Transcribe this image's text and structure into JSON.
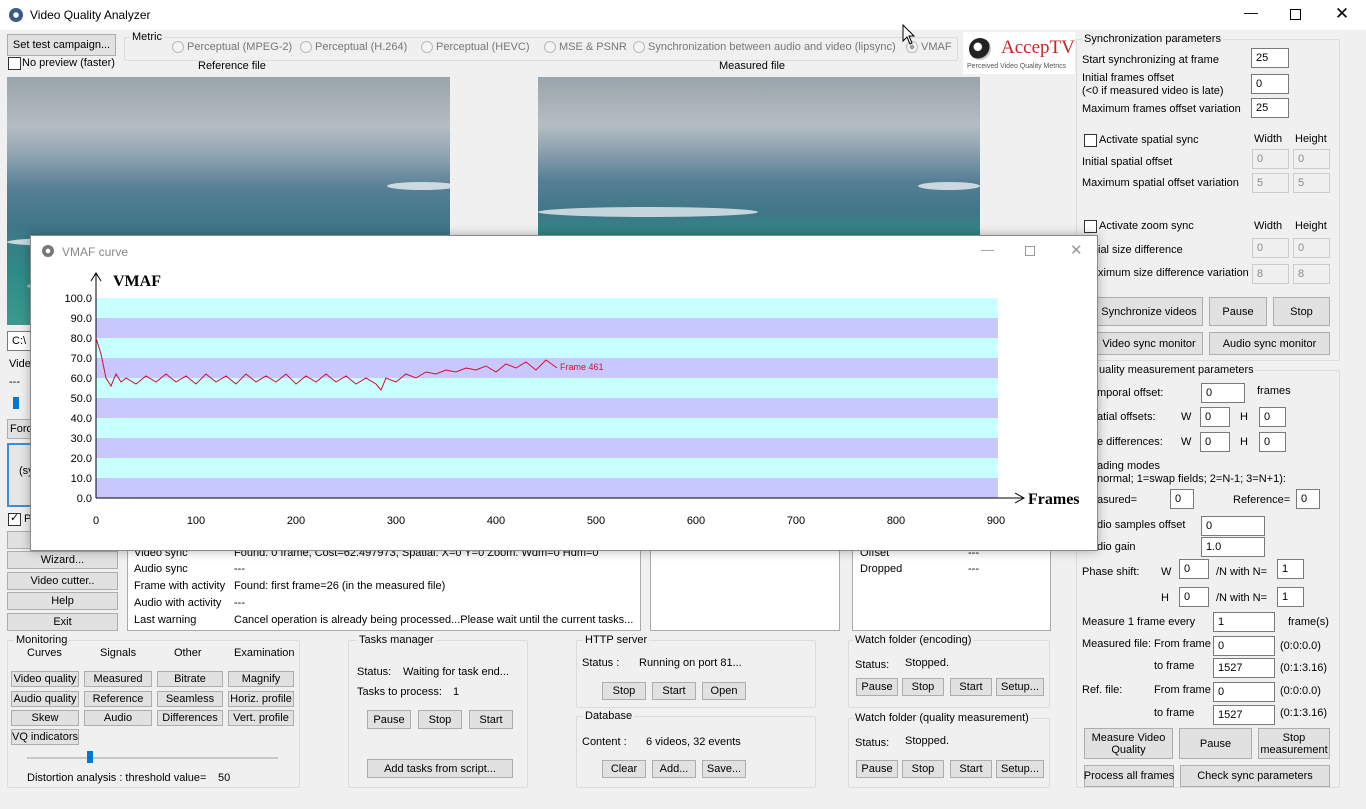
{
  "app": {
    "title": "Video Quality Analyzer",
    "logo_brand": "AccepTV",
    "logo_tagline": "Perceived Video Quality Metrics"
  },
  "top": {
    "set_campaign": "Set test campaign...",
    "no_preview": "No preview (faster)",
    "metric_label": "Metric",
    "metrics": [
      "Perceptual (MPEG-2)",
      "Perceptual (H.264)",
      "Perceptual (HEVC)",
      "MSE & PSNR",
      "Synchronization between audio and video (lipsync)",
      "VMAF"
    ],
    "reference_file": "Reference file",
    "measured_file": "Measured file"
  },
  "left": {
    "path_fragment": "C:\\",
    "video_fragment": "Vide",
    "dashes": "---",
    "force_fragment": "Forc",
    "sy_fragment": "(sy",
    "p_fragment": "P",
    "wizard": "Wizard...",
    "video_cutter": "Video cutter..",
    "help": "Help",
    "exit": "Exit"
  },
  "log": {
    "rows": [
      {
        "k": "Video sync",
        "v": "Found: 0 frame, Cost=62.497973, Spatial: X=0 Y=0 Zoom: Wdm=0 Hdm=0"
      },
      {
        "k": "Audio sync",
        "v": "---"
      },
      {
        "k": "Frame with activity",
        "v": "Found: first frame=26 (in the measured file)"
      },
      {
        "k": "Audio with activity",
        "v": "---"
      },
      {
        "k": "Last warning",
        "v": "Cancel operation is already being processed...Please wait until the current tasks..."
      }
    ],
    "offset_label": "Offset",
    "offset_value": "---",
    "dropped_label": "Dropped",
    "dropped_value": "---"
  },
  "monitoring": {
    "title": "Monitoring",
    "headers": [
      "Curves",
      "Signals",
      "Other",
      "Examination"
    ],
    "buttons": [
      [
        "Video quality",
        "Measured",
        "Bitrate",
        "Magnify"
      ],
      [
        "Audio quality",
        "Reference",
        "Seamless",
        "Horiz. profile"
      ],
      [
        "Skew",
        "Audio",
        "Differences",
        "Vert. profile"
      ],
      [
        "VQ indicators"
      ]
    ],
    "threshold_label": "Distortion analysis : threshold value=",
    "threshold_value": "50",
    "threshold_fraction": 0.25
  },
  "tasks": {
    "title": "Tasks manager",
    "status_label": "Status:",
    "status_value": "Waiting for task end...",
    "to_process_label": "Tasks to process:",
    "to_process_value": "1",
    "pause": "Pause",
    "stop": "Stop",
    "start": "Start",
    "add_script": "Add tasks from script..."
  },
  "http": {
    "title": "HTTP server",
    "status_label": "Status :",
    "status_value": "Running on port 81...",
    "stop": "Stop",
    "start": "Start",
    "open": "Open"
  },
  "database": {
    "title": "Database",
    "content_label": "Content :",
    "content_value": "6 videos, 32 events",
    "clear": "Clear",
    "add": "Add...",
    "save": "Save..."
  },
  "watch_encoding": {
    "title": "Watch folder (encoding)",
    "status_label": "Status:",
    "status_value": "Stopped.",
    "pause": "Pause",
    "stop": "Stop",
    "start": "Start",
    "setup": "Setup..."
  },
  "watch_quality": {
    "title": "Watch folder (quality measurement)",
    "status_label": "Status:",
    "status_value": "Stopped.",
    "pause": "Pause",
    "stop": "Stop",
    "start": "Start",
    "setup": "Setup..."
  },
  "sync": {
    "title": "Synchronization parameters",
    "start_label": "Start synchronizing at frame",
    "start_value": "25",
    "initial_offset_label": "Initial frames offset",
    "initial_offset_sub": "(<0 if measured video is late)",
    "initial_offset_value": "0",
    "max_offset_label": "Maximum frames offset variation",
    "max_offset_value": "25",
    "spatial_chk": "Activate spatial sync",
    "width": "Width",
    "height": "Height",
    "initial_spatial": "Initial spatial offset",
    "is_w": "0",
    "is_h": "0",
    "max_spatial": "Maximum spatial offset variation",
    "ms_w": "5",
    "ms_h": "5",
    "zoom_chk": "Activate zoom sync",
    "initial_size": "ial size difference",
    "iz_w": "0",
    "iz_h": "0",
    "max_size": "ximum size difference variation",
    "mz_w": "8",
    "mz_h": "8",
    "sync_videos": "Synchronize videos",
    "pause": "Pause",
    "stop": "Stop",
    "video_monitor": "Video sync monitor",
    "audio_monitor": "Audio sync monitor"
  },
  "quality": {
    "title": "uality measurement parameters",
    "temporal_label": "mporal offset:",
    "temporal_value": "0",
    "frames": "frames",
    "spatial_label": "atial offsets:",
    "w": "W",
    "h": "H",
    "so_w": "0",
    "so_h": "0",
    "size_label": "e differences:",
    "sd_w": "0",
    "sd_h": "0",
    "reading_label": "ading modes",
    "reading_sub": "normal; 1=swap fields; 2=N-1; 3=N+1):",
    "measured_label": "asured=",
    "measured_value": "0",
    "reference_label": "Reference=",
    "reference_value": "0",
    "audio_offset_label": "dio samples offset",
    "audio_offset_value": "0",
    "audio_gain_label": "dio gain",
    "audio_gain_value": "1.0",
    "phase_label": "Phase shift:",
    "pw": "0",
    "n_label": "/N with N=",
    "pw_n": "1",
    "ph": "0",
    "ph_n": "1",
    "measure_every_label": "Measure 1 frame every",
    "measure_every_value": "1",
    "frames_unit": "frame(s)",
    "measured_file_label": "Measured file:",
    "from_frame": "From frame",
    "mf_from": "0",
    "mf_from_time": "(0:0:0.0)",
    "to_frame": "to frame",
    "mf_to": "1527",
    "mf_to_time": "(0:1:3.16)",
    "ref_file_label": "Ref. file:",
    "rf_from": "0",
    "rf_from_time": "(0:0:0.0)",
    "rf_to": "1527",
    "rf_to_time": "(0:1:3.16)",
    "measure_btn": "Measure Video Quality",
    "pause": "Pause",
    "stop_btn": "Stop measurement",
    "process_all": "Process all frames",
    "check_sync": "Check sync parameters"
  },
  "vmaf_window": {
    "title": "VMAF curve",
    "y_title": "VMAF",
    "x_title": "Frames",
    "frame_label": "Frame 461"
  },
  "chart_data": {
    "type": "line",
    "title": "",
    "ylabel": "VMAF",
    "xlabel": "Frames",
    "xlim": [
      0,
      900
    ],
    "ylim": [
      0,
      100
    ],
    "x_ticks": [
      0,
      100,
      200,
      300,
      400,
      500,
      600,
      700,
      800,
      900
    ],
    "y_ticks": [
      "0.0",
      "10.0",
      "20.0",
      "30.0",
      "40.0",
      "50.0",
      "60.0",
      "70.0",
      "80.0",
      "90.0",
      "100.0"
    ],
    "band_colors": [
      "#c8c8ff",
      "#c8ffff"
    ],
    "line_color": "#d01030",
    "series": [
      {
        "x": [
          0,
          5,
          10,
          15,
          20,
          25,
          30,
          40,
          50,
          60,
          70,
          80,
          90,
          100,
          110,
          120,
          130,
          140,
          150,
          160,
          170,
          180,
          190,
          200,
          210,
          220,
          230,
          240,
          250,
          260,
          270,
          280,
          285,
          290,
          300,
          310,
          320,
          330,
          340,
          350,
          360,
          370,
          380,
          390,
          400,
          410,
          420,
          430,
          440,
          450,
          461
        ],
        "y": [
          80,
          72,
          60,
          56,
          62,
          58,
          60,
          57,
          61,
          58,
          62,
          58,
          61,
          57,
          62,
          58,
          61,
          57,
          62,
          58,
          61,
          58,
          62,
          57,
          61,
          58,
          62,
          58,
          61,
          57,
          60,
          57,
          54,
          60,
          58,
          62,
          60,
          63,
          62,
          64,
          63,
          65,
          64,
          66,
          63,
          67,
          65,
          68,
          64,
          69,
          65
        ]
      }
    ]
  }
}
